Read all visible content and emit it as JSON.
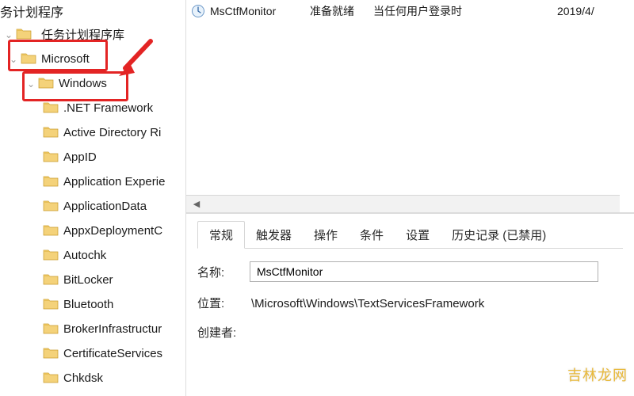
{
  "title_fragment": "务计划程序",
  "tree": {
    "library_label": "任务计划程序库",
    "microsoft": "Microsoft",
    "windows": "Windows",
    "items": [
      ".NET Framework",
      "Active Directory Ri",
      "AppID",
      "Application Experie",
      "ApplicationData",
      "AppxDeploymentC",
      "Autochk",
      "BitLocker",
      "Bluetooth",
      "BrokerInfrastructur",
      "CertificateServices",
      "Chkdsk"
    ]
  },
  "task_row": {
    "name": "MsCtfMonitor",
    "status": "准备就绪",
    "trigger": "当任何用户登录时",
    "date": "2019/4/"
  },
  "tabs": {
    "general": "常规",
    "triggers": "触发器",
    "actions": "操作",
    "conditions": "条件",
    "settings": "设置",
    "history": "历史记录 (已禁用)"
  },
  "detail": {
    "name_label": "名称:",
    "name_value": "MsCtfMonitor",
    "location_label": "位置:",
    "location_value": "\\Microsoft\\Windows\\TextServicesFramework",
    "creator_label": "创建者:"
  },
  "watermark": "吉林龙网"
}
